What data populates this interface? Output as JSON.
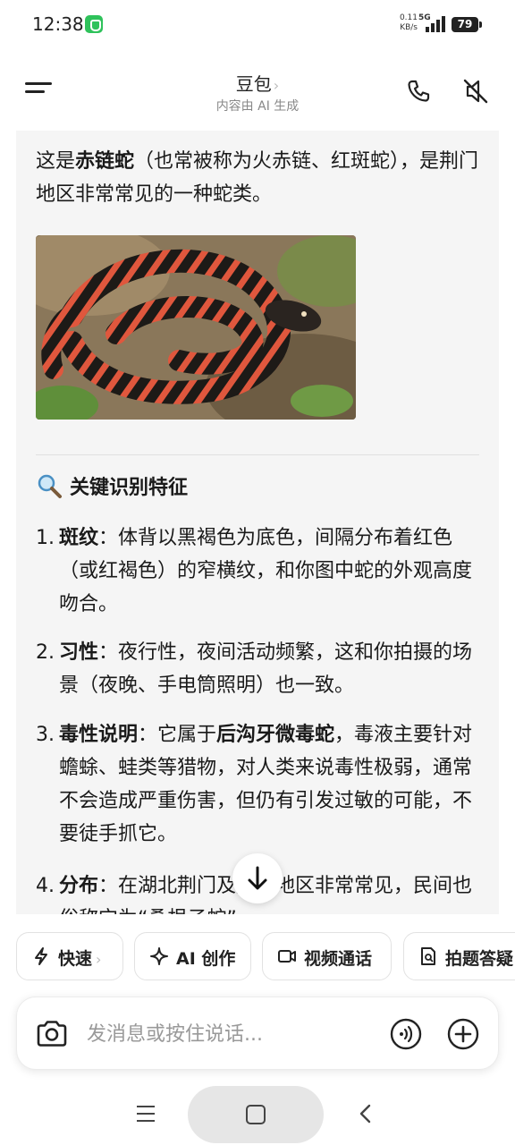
{
  "status": {
    "time": "12:38",
    "speed_value": "0.11",
    "speed_unit": "KB/s",
    "network": "5G",
    "battery": "79"
  },
  "header": {
    "title": "豆包",
    "subtitle": "内容由 AI 生成"
  },
  "message": {
    "intro_prefix": "这是",
    "intro_bold": "赤链蛇",
    "intro_suffix": "（也常被称为火赤链、红斑蛇），是荆门地区非常常见的一种蛇类。",
    "section_title": "关键识别特征",
    "items": [
      {
        "num": "1.",
        "title": "斑纹",
        "text": "：体背以黑褐色为底色，间隔分布着红色（或红褐色）的窄横纹，和你图中蛇的外观高度吻合。"
      },
      {
        "num": "2.",
        "title": "习性",
        "text": "：夜行性，夜间活动频繁，这和你拍摄的场景（夜晚、手电筒照明）也一致。"
      },
      {
        "num": "3.",
        "title": "毒性说明",
        "text_a": "：它属于",
        "bold_b": "后沟牙微毒蛇",
        "text_c": "，毒液主要针对蟾蜍、蛙类等猎物，对人类来说毒性极弱，通常不会造成严重伤害，但仍有引发过敏的可能，不要徒手抓它。"
      },
      {
        "num": "4.",
        "title": "分布",
        "text": "：在湖北荆门及周边地区非常常见，民间也俗称它为“桑根子蛇”。"
      }
    ]
  },
  "chips": [
    {
      "label": "快速",
      "icon": "lightning-icon"
    },
    {
      "label": "AI 创作",
      "icon": "sparkle-icon"
    },
    {
      "label": "视频通话",
      "icon": "video-icon"
    },
    {
      "label": "拍题答疑",
      "icon": "document-search-icon"
    }
  ],
  "input": {
    "placeholder": "发消息或按住说话..."
  },
  "colors": {
    "card_bg": "#f5f5f5",
    "text": "#1a1a1a",
    "muted": "#888888"
  }
}
